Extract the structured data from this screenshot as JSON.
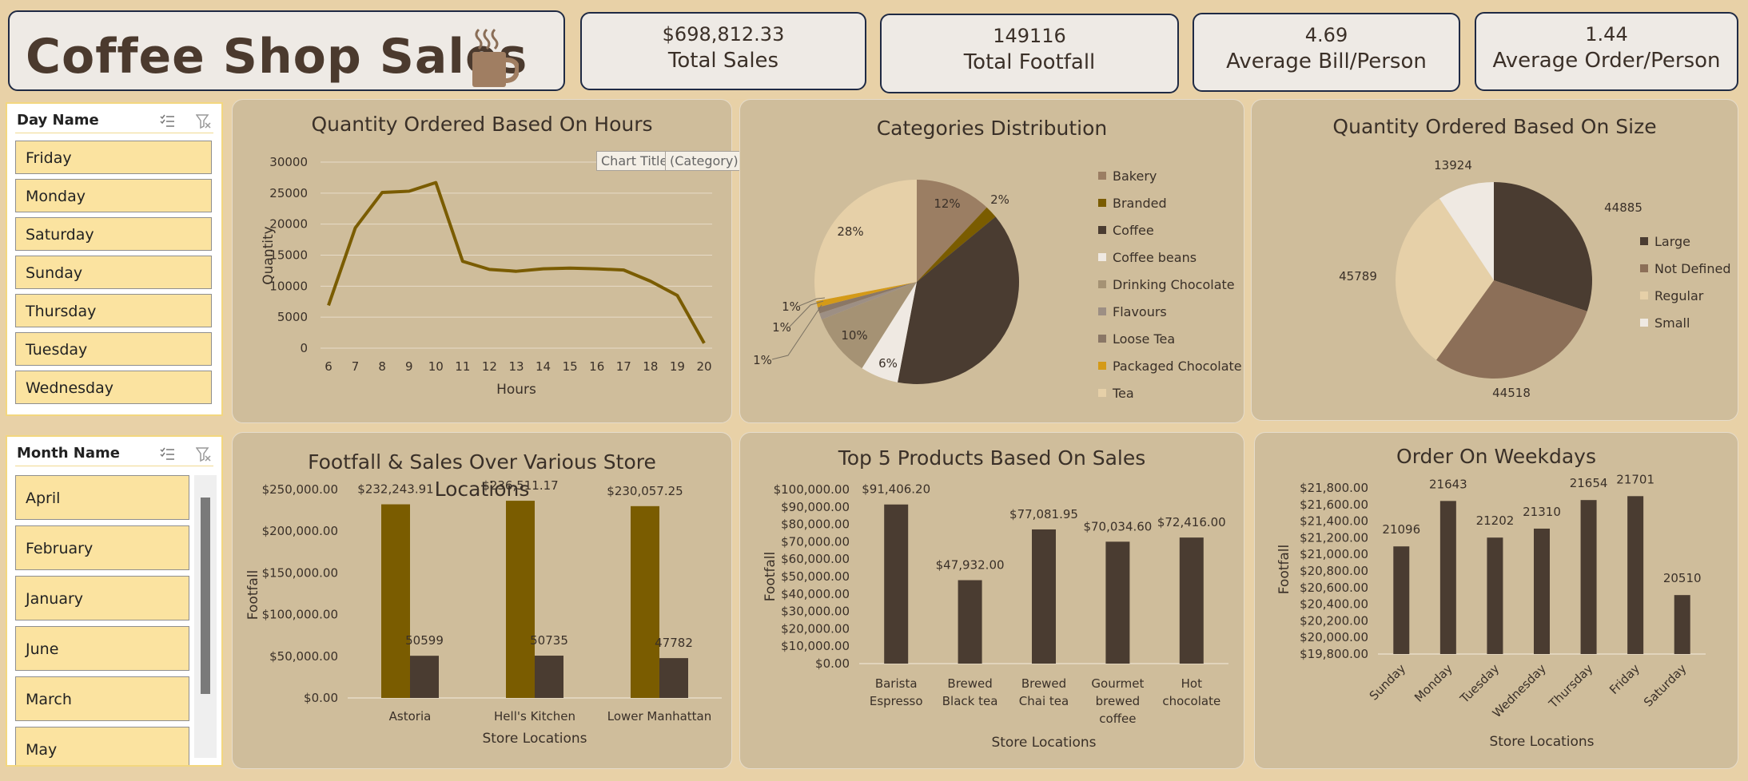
{
  "header": {
    "title": "Coffee Shop Sales",
    "cup_icon": "coffee-cup-icon"
  },
  "kpis": [
    {
      "value": "$698,812.33",
      "label": "Total Sales"
    },
    {
      "value": "149116",
      "label": "Total Footfall"
    },
    {
      "value": "4.69",
      "label": "Average Bill/Person"
    },
    {
      "value": "1.44",
      "label": "Average Order/Person"
    }
  ],
  "day_slicer": {
    "title": "Day Name",
    "items": [
      "Friday",
      "Monday",
      "Saturday",
      "Sunday",
      "Thursday",
      "Tuesday",
      "Wednesday"
    ]
  },
  "month_slicer": {
    "title": "Month Name",
    "items": [
      "April",
      "February",
      "January",
      "June",
      "March",
      "May"
    ]
  },
  "tooltip": {
    "chart_title": "Chart Title",
    "axis_title": "(Category) Axis Title"
  },
  "colors": {
    "brown_dark": "#4a3c31",
    "olive": "#7a5c00",
    "bg": "#cfbd9b"
  },
  "chart_data": [
    {
      "id": "hours",
      "type": "line",
      "title": "Quantity Ordered Based On Hours",
      "xlabel": "Hours",
      "ylabel": "Quantity",
      "x": [
        6,
        7,
        8,
        9,
        10,
        11,
        12,
        13,
        14,
        15,
        16,
        17,
        18,
        19,
        20
      ],
      "values": [
        6900,
        19400,
        25100,
        25300,
        26700,
        14000,
        12700,
        12400,
        12800,
        12900,
        12800,
        12600,
        10800,
        8500,
        800
      ],
      "ylim": [
        0,
        30000
      ],
      "yticks": [
        "30000",
        "25000",
        "20000",
        "15000",
        "10000",
        "5000",
        "0"
      ]
    },
    {
      "id": "categories",
      "type": "pie",
      "title": "Categories Distribution",
      "labels": [
        "Bakery",
        "Branded",
        "Coffee",
        "Coffee beans",
        "Drinking Chocolate",
        "Flavours",
        "Loose Tea",
        "Packaged Chocolate",
        "Tea"
      ],
      "values": [
        12,
        2,
        39,
        6,
        10,
        1,
        1,
        1,
        28
      ],
      "data_labels": [
        "12%",
        "2%",
        "",
        "6%",
        "10%",
        "1%",
        "1%",
        "1%",
        "28%"
      ],
      "colors": [
        "#9b7e63",
        "#7a5c00",
        "#4a3c31",
        "#efe9e2",
        "#a59274",
        "#9d8f84",
        "#8a7766",
        "#d49a18",
        "#e6d0a8"
      ]
    },
    {
      "id": "size",
      "type": "pie",
      "title": "Quantity Ordered Based On Size",
      "labels": [
        "Large",
        "Not Defined",
        "Regular",
        "Small"
      ],
      "values": [
        44885,
        44518,
        45789,
        13924
      ],
      "data_labels": [
        "44885",
        "44518",
        "45789",
        "13924"
      ],
      "colors": [
        "#4a3c31",
        "#8c6f58",
        "#e6d0a8",
        "#efe9e2"
      ]
    },
    {
      "id": "stores",
      "type": "bar",
      "title": "Footfall  & Sales Over Various Store Locations",
      "xlabel": "Store Locations",
      "ylabel": "Footfall",
      "categories": [
        "Astoria",
        "Hell's Kitchen",
        "Lower Manhattan"
      ],
      "series": [
        {
          "values": [
            232243.91,
            236511.17,
            230057.25
          ],
          "labels": [
            "$232,243.91",
            "$236,511.17",
            "$230,057.25"
          ],
          "color": "#7a5c00"
        },
        {
          "values": [
            50599,
            50735,
            47782
          ],
          "labels": [
            "50599",
            "50735",
            "47782"
          ],
          "color": "#4a3c31"
        }
      ],
      "ylim": [
        0,
        250000
      ],
      "yticks": [
        "$250,000.00",
        "$200,000.00",
        "$150,000.00",
        "$100,000.00",
        "$50,000.00",
        "$0.00"
      ]
    },
    {
      "id": "products",
      "type": "bar",
      "title": "Top 5 Products Based On Sales",
      "xlabel": "Store Locations",
      "ylabel": "Footfall",
      "categories": [
        "Barista Espresso",
        "Brewed Black tea",
        "Brewed Chai tea",
        "Gourmet brewed coffee",
        "Hot chocolate"
      ],
      "category_lines": [
        [
          "Barista",
          "Espresso"
        ],
        [
          "Brewed",
          "Black tea"
        ],
        [
          "Brewed",
          "Chai tea"
        ],
        [
          "Gourmet",
          "brewed",
          "coffee"
        ],
        [
          "Hot",
          "chocolate"
        ]
      ],
      "values": [
        91406.2,
        47932.0,
        77081.95,
        70034.6,
        72416.0
      ],
      "labels": [
        "$91,406.20",
        "$47,932.00",
        "$77,081.95",
        "$70,034.60",
        "$72,416.00"
      ],
      "ylim": [
        0,
        100000
      ],
      "yticks": [
        "$100,000.00",
        "$90,000.00",
        "$80,000.00",
        "$70,000.00",
        "$60,000.00",
        "$50,000.00",
        "$40,000.00",
        "$30,000.00",
        "$20,000.00",
        "$10,000.00",
        "$0.00"
      ]
    },
    {
      "id": "weekdays",
      "type": "bar",
      "title": "Order On Weekdays",
      "xlabel": "Store Locations",
      "ylabel": "Footfall",
      "categories": [
        "Sunday",
        "Monday",
        "Tuesday",
        "Wednesday",
        "Thursday",
        "Friday",
        "Saturday"
      ],
      "values": [
        21096,
        21643,
        21202,
        21310,
        21654,
        21701,
        20510
      ],
      "labels": [
        "21096",
        "21643",
        "21202",
        "21310",
        "21654",
        "21701",
        "20510"
      ],
      "ylim": [
        19800,
        21800
      ],
      "yticks": [
        "$21,800.00",
        "$21,600.00",
        "$21,400.00",
        "$21,200.00",
        "$21,000.00",
        "$20,800.00",
        "$20,600.00",
        "$20,400.00",
        "$20,200.00",
        "$20,000.00",
        "$19,800.00"
      ]
    }
  ]
}
